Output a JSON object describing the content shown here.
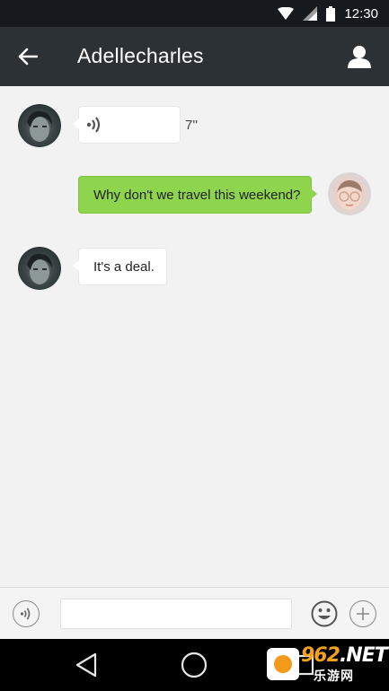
{
  "status_bar": {
    "time": "12:30",
    "icons": [
      "wifi-icon",
      "cell-signal-icon",
      "battery-icon"
    ]
  },
  "header": {
    "title": "Adellecharles",
    "back_icon": "arrow-left-icon",
    "profile_icon": "person-icon"
  },
  "messages": [
    {
      "direction": "incoming",
      "type": "voice",
      "duration": "7''",
      "icon": "voice-wave-icon"
    },
    {
      "direction": "outgoing",
      "type": "text",
      "text": "Why don't we travel this weekend?"
    },
    {
      "direction": "incoming",
      "type": "text",
      "text": "It's a deal."
    }
  ],
  "input_bar": {
    "voice_icon": "voice-wave-icon",
    "value": "",
    "placeholder": "",
    "emoji_icon": "smiley-icon",
    "plus_icon": "plus-icon"
  },
  "nav_bar": {
    "icons": [
      "nav-back-icon",
      "nav-home-icon",
      "nav-recents-icon"
    ]
  },
  "watermark": {
    "brand_number": "962",
    "brand_suffix": ".NET",
    "brand_chinese": "乐游网"
  },
  "colors": {
    "status_bar": "#16191d",
    "app_bar": "#2c3136",
    "chat_background": "#f2f2f2",
    "outgoing_bubble": "#8ed44c",
    "incoming_bubble": "#ffffff",
    "nav_bar": "#000000"
  }
}
